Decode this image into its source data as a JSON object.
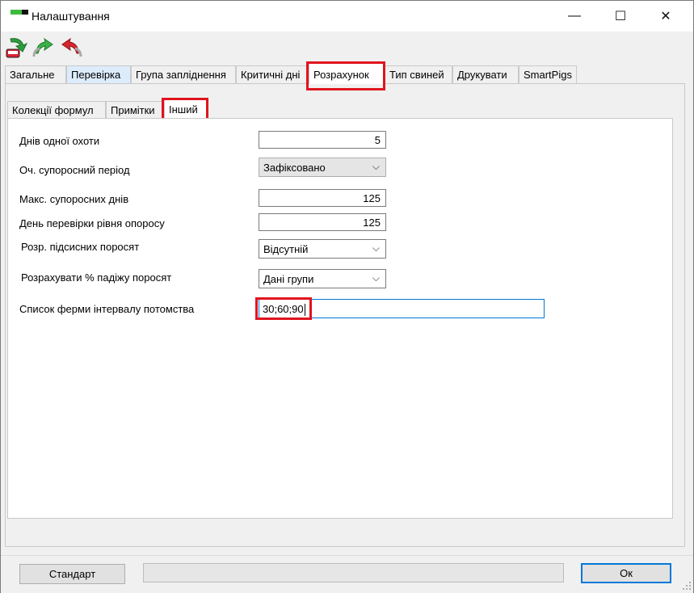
{
  "window": {
    "title": "Налаштування",
    "controls": {
      "minimize": "—",
      "maximize": "☐",
      "close": "✕"
    }
  },
  "toolbar": {
    "icons": [
      "save-icon",
      "forward-green-icon",
      "back-red-icon"
    ]
  },
  "main_tabs": [
    {
      "label": "Загальне",
      "state": "normal"
    },
    {
      "label": "Перевірка",
      "state": "light"
    },
    {
      "label": "Група запліднення",
      "state": "normal"
    },
    {
      "label": "Критичні дні",
      "state": "normal"
    },
    {
      "label": "Розрахунок",
      "state": "active"
    },
    {
      "label": "Тип свиней",
      "state": "normal"
    },
    {
      "label": "Друкувати",
      "state": "normal"
    },
    {
      "label": "SmartPigs",
      "state": "normal"
    }
  ],
  "sub_tabs": [
    {
      "label": "Колекції формул",
      "state": "normal"
    },
    {
      "label": "Примітки",
      "state": "normal"
    },
    {
      "label": "Інший",
      "state": "active"
    }
  ],
  "form": {
    "heat_days": {
      "label": "Днів одної охоти",
      "value": "5"
    },
    "expected_gestation": {
      "label": "Оч. супоросний період",
      "value": "Зафіксовано"
    },
    "max_gestation_days": {
      "label": "Макс. супоросних днів",
      "value": "125"
    },
    "farrowing_check_day": {
      "label": "День перевірки рівня опоросу",
      "value": "125"
    },
    "nursing_piglets": {
      "label": "Розр. підсисних поросят",
      "value": "Відсутній"
    },
    "piglet_mortality": {
      "label": "Розрахувати % падіжу поросят",
      "value": "Дані групи"
    },
    "offspring_interval": {
      "label": "Список ферми інтервалу потомства",
      "value": "30;60;90"
    }
  },
  "bottom": {
    "default_button": "Стандарт",
    "ok_button": "Ок",
    "progress": 0
  },
  "colors": {
    "highlight": "#e0141e",
    "focus_blue": "#0078d7",
    "tab_light": "#dcecfb"
  }
}
